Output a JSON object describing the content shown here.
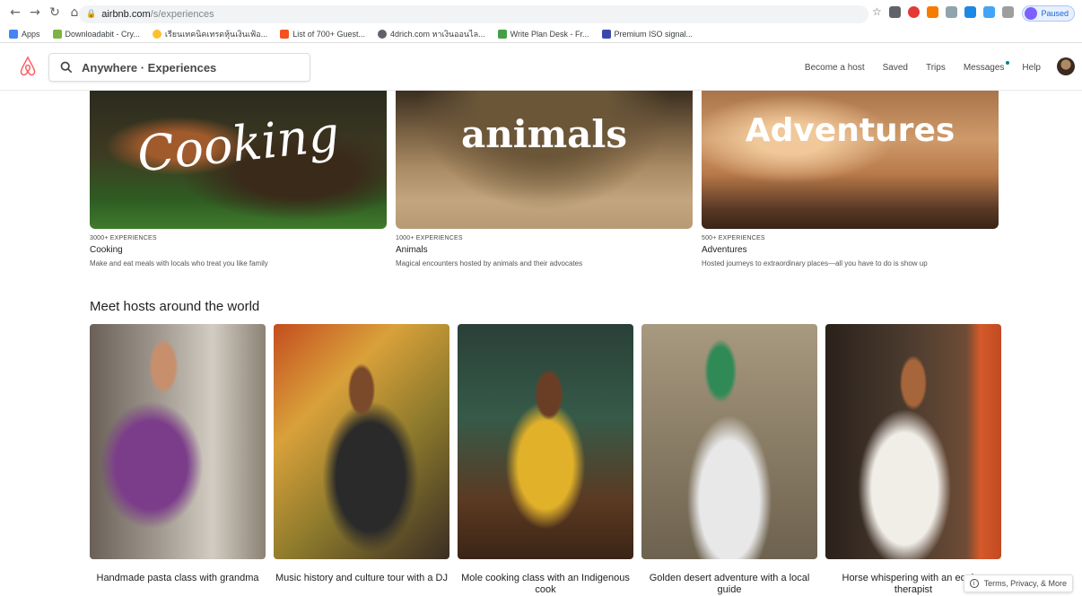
{
  "browser": {
    "url_host": "airbnb.com",
    "url_path": "/s/experiences",
    "profile_status": "Paused",
    "bookmarks": [
      {
        "label": "Apps",
        "color": "#4285f4"
      },
      {
        "label": "Downloadabit - Cry...",
        "color": "#7cb342"
      },
      {
        "label": "เรียนเทคนิคเทรดหุ้นเงินเฟ้อ...",
        "color": "#fbc02d"
      },
      {
        "label": "List of 700+ Guest...",
        "color": "#f4511e"
      },
      {
        "label": "4drich.com หาเงินออนไล...",
        "color": "#5f6368"
      },
      {
        "label": "Write Plan Desk - Fr...",
        "color": "#43a047"
      },
      {
        "label": "Premium ISO signal...",
        "color": "#3949ab"
      }
    ]
  },
  "header": {
    "search_value": "Anywhere · Experiences",
    "nav": {
      "become_host": "Become a host",
      "saved": "Saved",
      "trips": "Trips",
      "messages": "Messages",
      "help": "Help"
    }
  },
  "categories": [
    {
      "word": "Cooking",
      "meta": "3000+ EXPERIENCES",
      "title": "Cooking",
      "desc": "Make and eat meals with locals who treat you like family"
    },
    {
      "word": "animals",
      "meta": "1000+ EXPERIENCES",
      "title": "Animals",
      "desc": "Magical encounters hosted by animals and their advocates"
    },
    {
      "word": "Adventures",
      "meta": "500+ EXPERIENCES",
      "title": "Adventures",
      "desc": "Hosted journeys to extraordinary places—all you have to do is show up"
    }
  ],
  "hosts_section": {
    "title": "Meet hosts around the world",
    "items": [
      {
        "title": "Handmade pasta class with grandma"
      },
      {
        "title": "Music history and culture tour with a DJ"
      },
      {
        "title": "Mole cooking class with an Indigenous cook"
      },
      {
        "title": "Golden desert adventure with a local guide"
      },
      {
        "title": "Horse whispering with an equine therapist"
      }
    ]
  },
  "footer": {
    "terms": "Terms, Privacy, & More"
  },
  "colors": {
    "brand": "#FF5A5F",
    "accent": "#008489"
  }
}
